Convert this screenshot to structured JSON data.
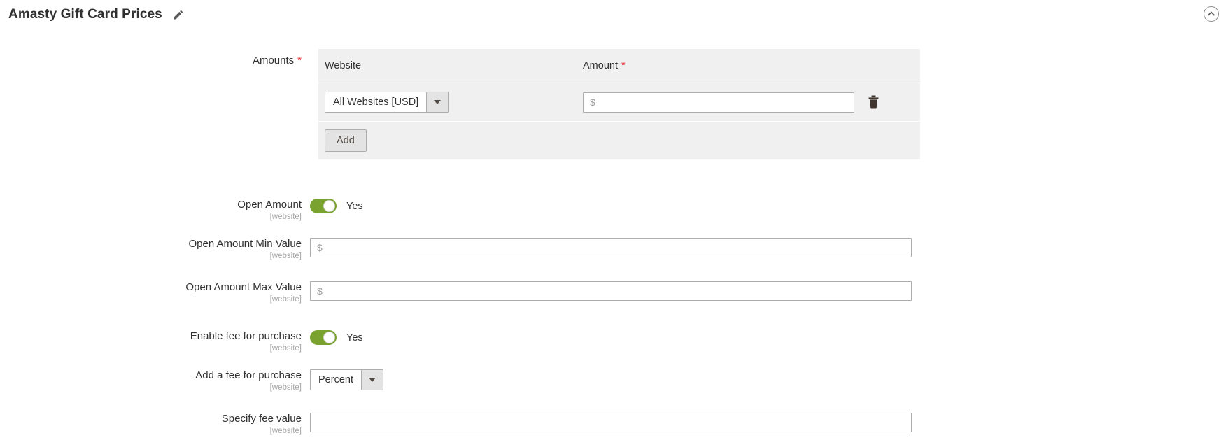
{
  "header": {
    "title": "Amasty Gift Card Prices",
    "edit_icon": "pencil-icon",
    "collapse_icon": "chevron-up-circle-icon"
  },
  "amounts": {
    "label": "Amounts",
    "required_marker": "*",
    "columns": {
      "website": "Website",
      "amount": "Amount",
      "amount_required_marker": "*"
    },
    "rows": [
      {
        "website_value": "All Websites [USD]",
        "amount_value": "",
        "amount_placeholder": "$",
        "delete_icon": "trash-icon"
      }
    ],
    "add_label": "Add"
  },
  "fields": {
    "open_amount": {
      "label": "Open Amount",
      "scope": "[website]",
      "toggle_state": "on",
      "toggle_text": "Yes"
    },
    "open_amount_min": {
      "label": "Open Amount Min Value",
      "scope": "[website]",
      "value": "",
      "placeholder": "$"
    },
    "open_amount_max": {
      "label": "Open Amount Max Value",
      "scope": "[website]",
      "value": "",
      "placeholder": "$"
    },
    "enable_fee": {
      "label": "Enable fee for purchase",
      "scope": "[website]",
      "toggle_state": "on",
      "toggle_text": "Yes"
    },
    "add_fee": {
      "label": "Add a fee for purchase",
      "scope": "[website]",
      "selected": "Percent"
    },
    "fee_value": {
      "label": "Specify fee value",
      "scope": "[website]",
      "value": "",
      "placeholder": ""
    }
  },
  "colors": {
    "toggle_on": "#79a22e",
    "required": "#e02b27",
    "table_bg": "#f0f0f0",
    "text": "#303030",
    "scope_text": "#a6a6a6"
  }
}
